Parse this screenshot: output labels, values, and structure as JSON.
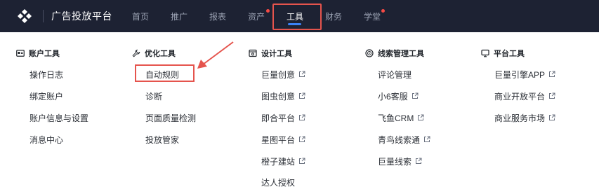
{
  "brand": {
    "title": "广告投放平台"
  },
  "nav": {
    "items": [
      {
        "label": "首页"
      },
      {
        "label": "推广"
      },
      {
        "label": "报表"
      },
      {
        "label": "资产"
      },
      {
        "label": "工具"
      },
      {
        "label": "财务"
      },
      {
        "label": "学堂"
      }
    ],
    "active_index": 4,
    "dot_items": [
      3,
      6
    ]
  },
  "menu": {
    "account": {
      "title": "账户工具",
      "items": [
        "操作日志",
        "绑定账户",
        "账户信息与设置",
        "消息中心"
      ]
    },
    "optimize": {
      "title": "优化工具",
      "items": [
        "自动规则",
        "诊断",
        "页面质量检测",
        "投放管家"
      ]
    },
    "design": {
      "title": "设计工具",
      "items": [
        "巨量创意",
        "图虫创意",
        "即合平台",
        "星图平台",
        "橙子建站",
        "达人授权"
      ]
    },
    "leads": {
      "title": "线索管理工具",
      "items": [
        "评论管理",
        "小6客服",
        "飞鱼CRM",
        "青鸟线索通",
        "巨量线索"
      ]
    },
    "platform": {
      "title": "平台工具",
      "items": [
        "巨量引擎APP",
        "商业开放平台",
        "商业服务市场"
      ]
    }
  },
  "icons": {
    "logo": "logo-icon",
    "account": "id-card-icon",
    "optimize": "wrench-icon",
    "design": "design-icon",
    "leads": "target-icon",
    "platform": "monitor-icon",
    "external": "external-link-icon"
  },
  "colors": {
    "nav_bg": "#1d2233",
    "highlight": "#e5544d",
    "accent": "#3b82f6",
    "dot": "#f54a45"
  }
}
